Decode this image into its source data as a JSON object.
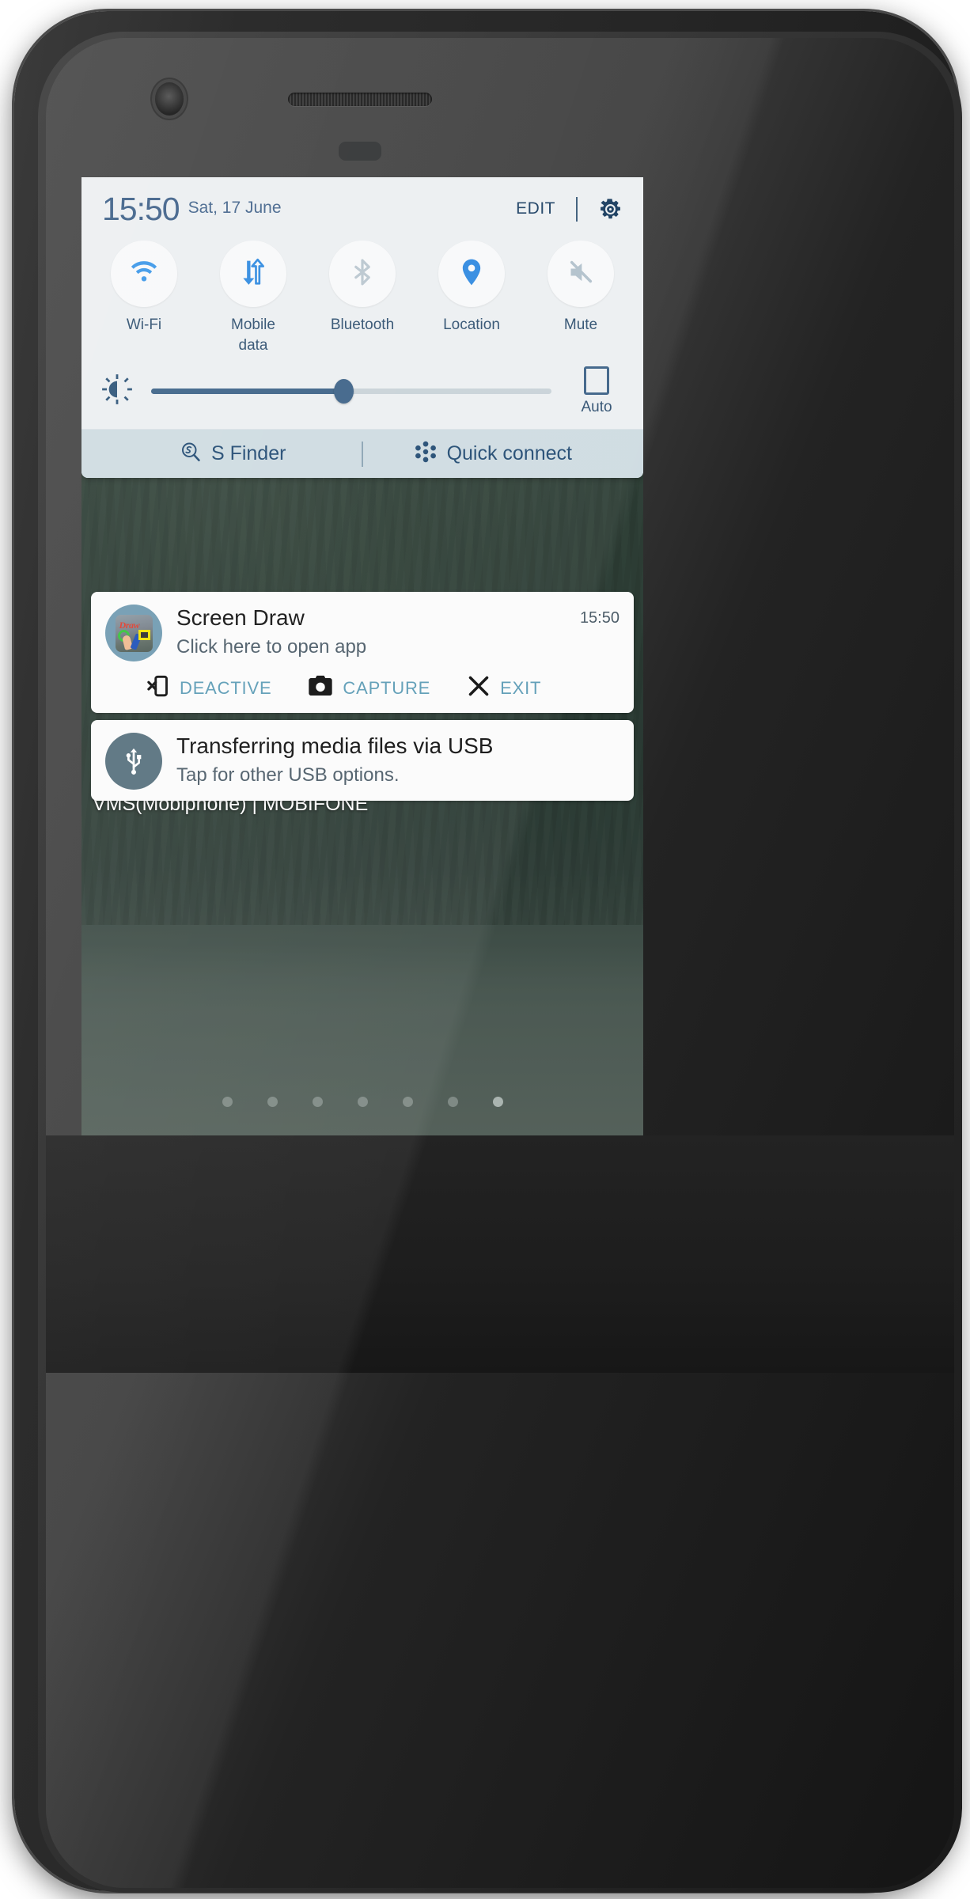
{
  "quick_settings": {
    "clock": "15:50",
    "date": "Sat, 17 June",
    "edit_label": "EDIT",
    "settings_icon": "gear-icon",
    "toggles": [
      {
        "label": "Wi-Fi",
        "icon": "wifi-icon",
        "state": "on"
      },
      {
        "label": "Mobile data",
        "icon": "mobile-data-icon",
        "state": "on"
      },
      {
        "label": "Bluetooth",
        "icon": "bluetooth-icon",
        "state": "off"
      },
      {
        "label": "Location",
        "icon": "location-pin-icon",
        "state": "on"
      },
      {
        "label": "Mute",
        "icon": "mute-icon",
        "state": "off"
      }
    ],
    "brightness": {
      "icon": "brightness-icon",
      "value_percent": 48,
      "auto_label": "Auto",
      "auto_checked": false
    },
    "shortcuts": [
      {
        "label": "S Finder",
        "icon": "s-finder-icon"
      },
      {
        "label": "Quick connect",
        "icon": "quick-connect-icon"
      }
    ]
  },
  "notifications": [
    {
      "app_icon": "screen-draw-app-icon",
      "title": "Screen Draw",
      "body": "Click here to open app",
      "time": "15:50",
      "actions": [
        {
          "label": "DEACTIVE",
          "icon": "phone-x-icon"
        },
        {
          "label": "CAPTURE",
          "icon": "camera-icon"
        },
        {
          "label": "EXIT",
          "icon": "close-x-icon"
        }
      ]
    },
    {
      "app_icon": "usb-icon",
      "title": "Transferring media files via USB",
      "body": "Tap for other USB options.",
      "time": "",
      "actions": []
    }
  ],
  "home": {
    "carrier": "VMS(Mobiphone) | MOBIFONE",
    "page_dots": {
      "count": 7,
      "active_index": 6
    }
  },
  "colors": {
    "panel_bg": "#eceff1",
    "finder_bar_bg": "#cedbe1",
    "accent_on": "#3b97e8",
    "accent_off": "#b9c6cf",
    "text_blue": "#2f5070",
    "action_blue": "#5b9bb5",
    "slider_fill": "#3c6287"
  }
}
